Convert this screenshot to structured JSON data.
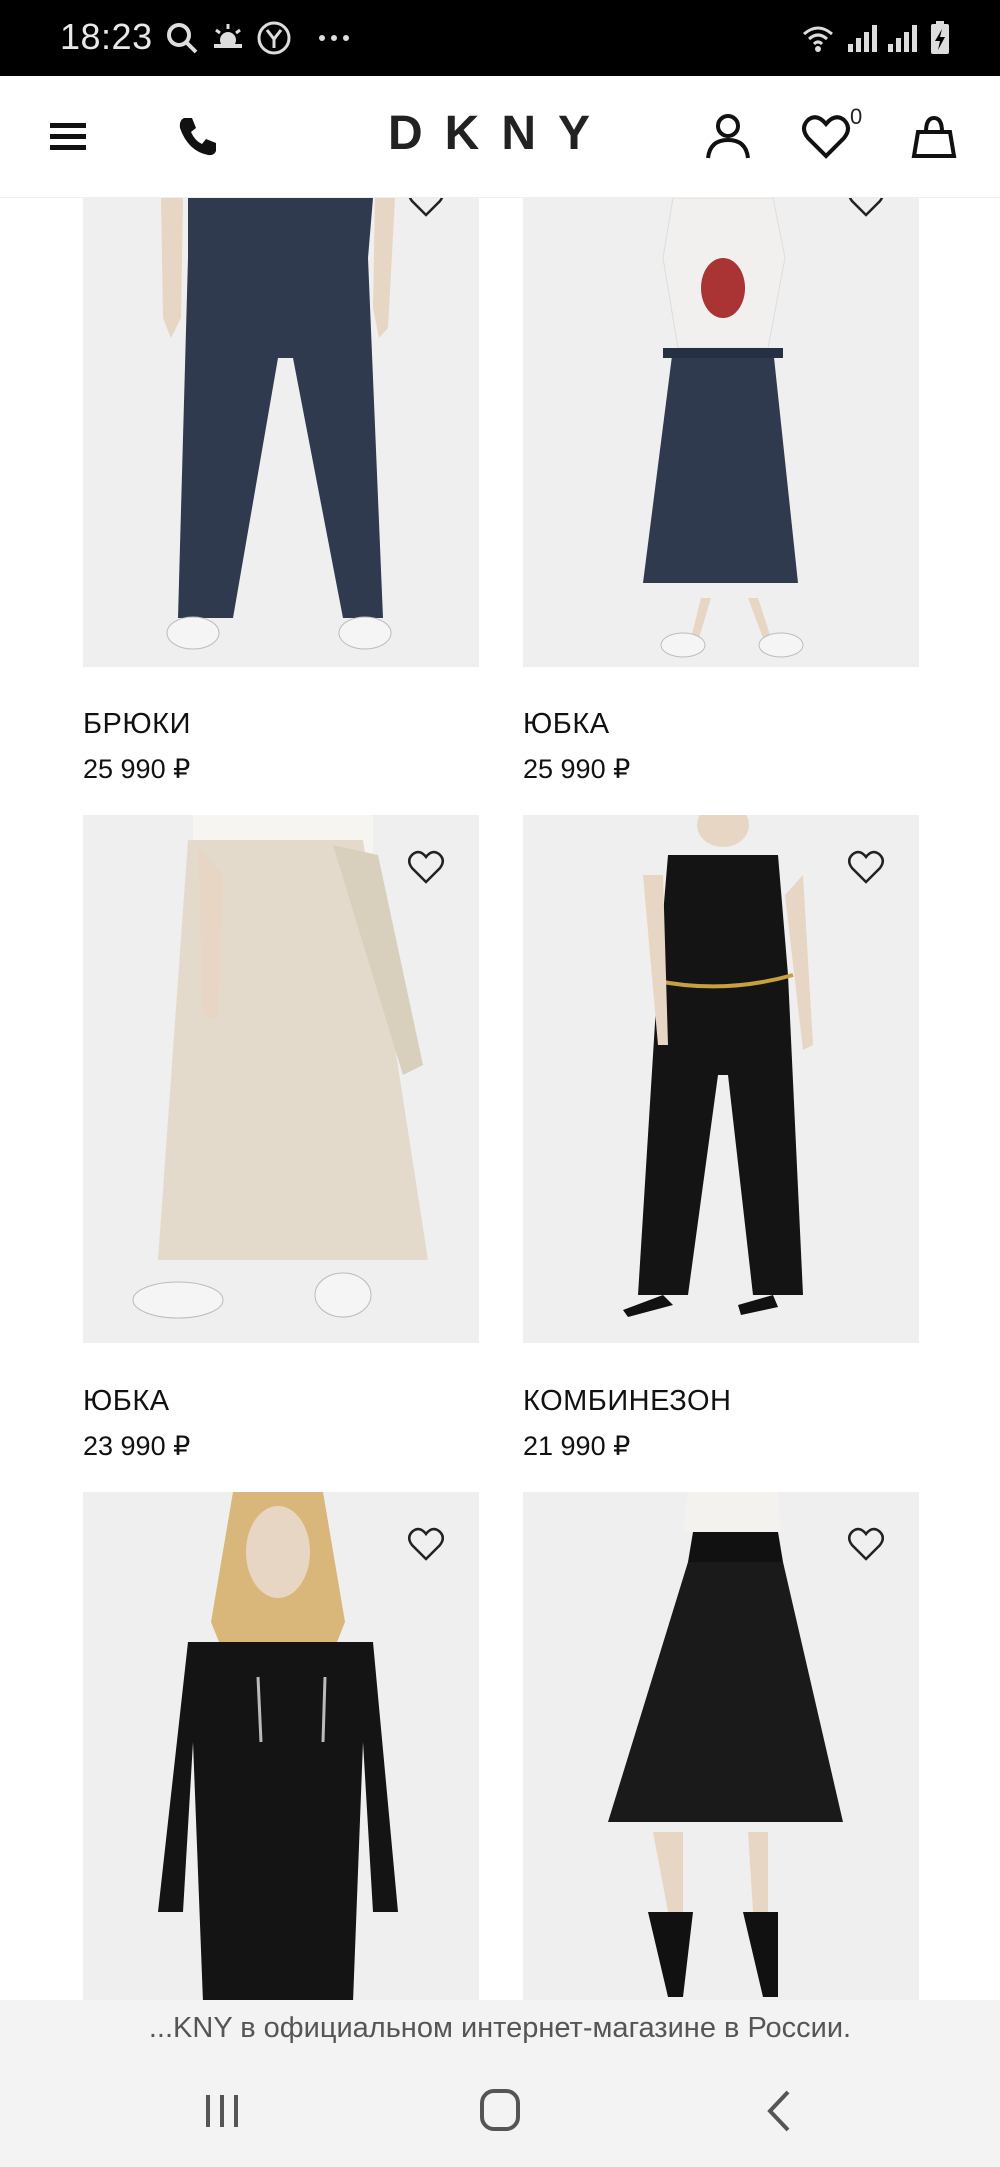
{
  "status_bar": {
    "time": "18:23"
  },
  "header": {
    "logo": "DKNY",
    "favorites_count": "0"
  },
  "products": [
    {
      "name": "БРЮКИ",
      "price": "25 990 ₽",
      "image": "navy-wide-trousers"
    },
    {
      "name": "ЮБКА",
      "price": "25 990 ₽",
      "image": "navy-midi-skirt"
    },
    {
      "name": "ЮБКА",
      "price": "23 990 ₽",
      "image": "beige-wrap-skirt"
    },
    {
      "name": "КОМБИНЕЗОН",
      "price": "21 990 ₽",
      "image": "black-jumpsuit"
    },
    {
      "name": "",
      "price": "",
      "image": "black-utility-jumpsuit"
    },
    {
      "name": "",
      "price": "",
      "image": "black-pleated-skirt"
    }
  ],
  "banner": {
    "text": "...KNY в официальном интернет-магазине в России."
  },
  "colors": {
    "status_bar": "#000000",
    "image_bg": "#efefef",
    "navy": "#2f3a4f",
    "beige": "#e3dacb",
    "black": "#141414"
  }
}
